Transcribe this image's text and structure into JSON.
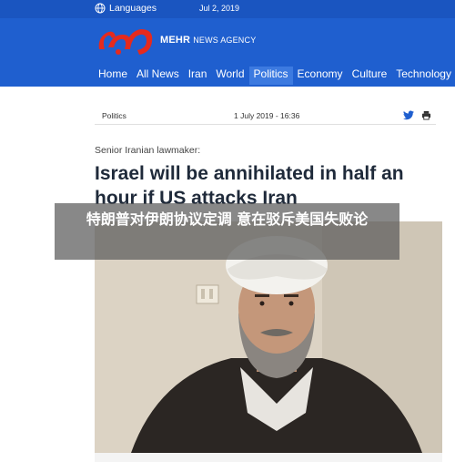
{
  "topbar": {
    "languages_label": "Languages",
    "date": "Jul 2, 2019"
  },
  "brand": {
    "name_bold": "MEHR",
    "name_rest": "NEWS AGENCY",
    "logo_color": "#e52a1e"
  },
  "nav": {
    "items": [
      {
        "label": "Home",
        "active": false
      },
      {
        "label": "All News",
        "active": false
      },
      {
        "label": "Iran",
        "active": false
      },
      {
        "label": "World",
        "active": false
      },
      {
        "label": "Politics",
        "active": true
      },
      {
        "label": "Economy",
        "active": false
      },
      {
        "label": "Culture",
        "active": false
      },
      {
        "label": "Technology",
        "active": false
      }
    ]
  },
  "article": {
    "category": "Politics",
    "date": "1 July 2019 - 16:36",
    "kicker": "Senior Iranian lawmaker:",
    "headline": "Israel will be annihilated in half an hour if US attacks Iran",
    "share_icons": [
      "twitter-icon",
      "print-icon"
    ]
  },
  "overlay": {
    "caption": "特朗普对伊朗协议定调 意在驳斥美国失败论"
  },
  "colors": {
    "header_blue": "#1f5fcf",
    "active_nav": "#3c7ae0",
    "headline": "#1f2a3a"
  }
}
